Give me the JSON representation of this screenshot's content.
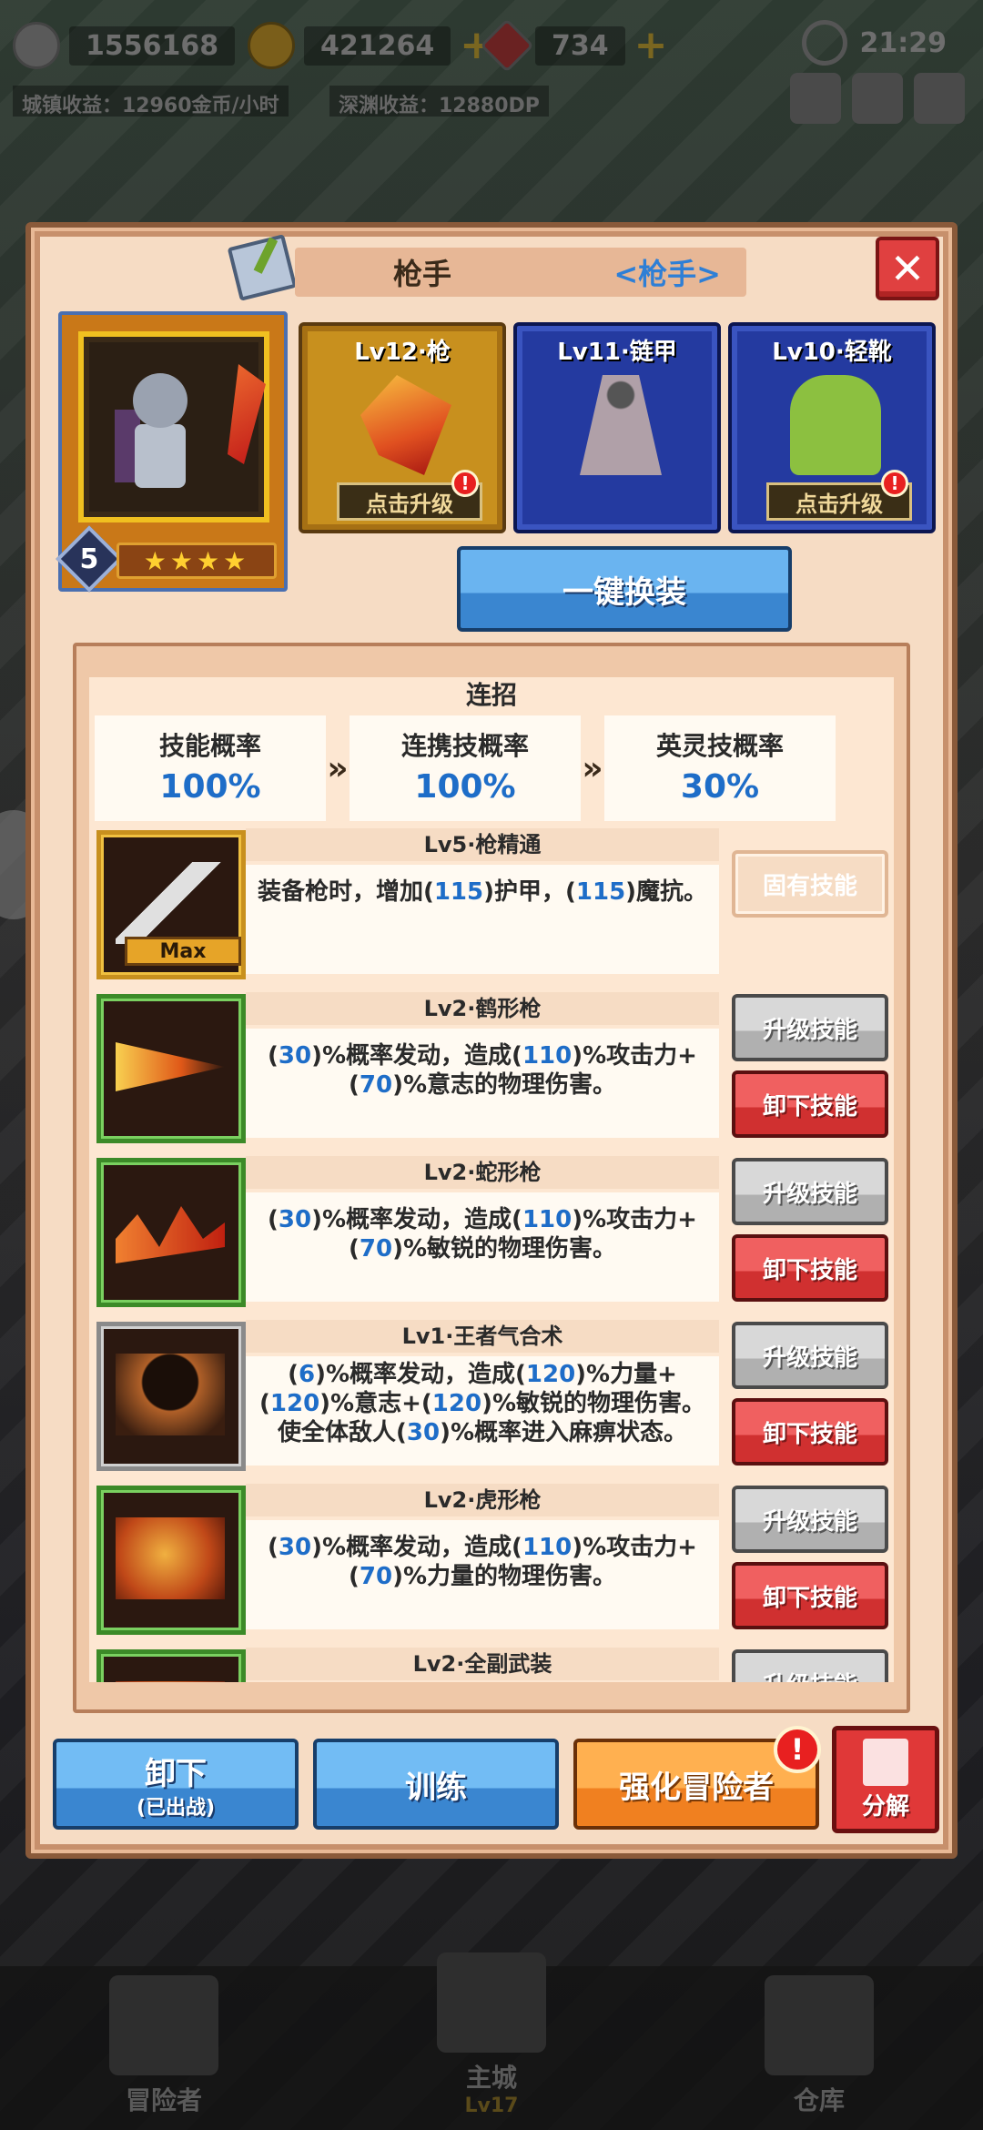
{
  "topbar": {
    "power": "1556168",
    "gold": "421264",
    "gems": "734",
    "time": "21:29",
    "city_income": "城镇收益：12960金币/小时",
    "abyss_income": "深渊收益：12880DP"
  },
  "modal": {
    "title": "枪手",
    "class_tag": "<枪手>",
    "close_label": "✕"
  },
  "hero": {
    "level": "5",
    "stars": "★★★★"
  },
  "equipment": [
    {
      "label": "Lv12·枪",
      "upgrade": "点击升级",
      "alert": "!"
    },
    {
      "label": "Lv11·链甲"
    },
    {
      "label": "Lv10·轻靴",
      "upgrade": "点击升级",
      "alert": "!"
    }
  ],
  "one_key_label": "一键换装",
  "combo": {
    "title": "连招",
    "items": [
      {
        "label": "技能概率",
        "value": "100%"
      },
      {
        "label": "连携技概率",
        "value": "100%"
      },
      {
        "label": "英灵技概率",
        "value": "30%"
      }
    ],
    "arrow": "»"
  },
  "skills": [
    {
      "title": "Lv5·枪精通",
      "desc": "装备枪时，增加(115)护甲，(115)魔抗。",
      "tag": "Max",
      "innate_label": "固有技能"
    },
    {
      "title": "Lv2·鹤形枪",
      "desc": "(30)%概率发动，造成(110)%攻击力+(70)%意志的物理伤害。",
      "up_label": "升级技能",
      "down_label": "卸下技能"
    },
    {
      "title": "Lv2·蛇形枪",
      "desc": "(30)%概率发动，造成(110)%攻击力+(70)%敏锐的物理伤害。",
      "up_label": "升级技能",
      "down_label": "卸下技能"
    },
    {
      "title": "Lv1·王者气合术",
      "desc": "(6)%概率发动，造成(120)%力量+(120)%意志+(120)%敏锐的物理伤害。使全体敌人(30)%概率进入麻痹状态。",
      "up_label": "升级技能",
      "down_label": "卸下技能"
    },
    {
      "title": "Lv2·虎形枪",
      "desc": "(30)%概率发动，造成(110)%攻击力+(70)%力量的物理伤害。",
      "up_label": "升级技能",
      "down_label": "卸下技能"
    },
    {
      "title": "Lv2·全副武装",
      "desc": "",
      "up_label": "升级技能",
      "down_label": ""
    }
  ],
  "bottom": {
    "unequip_main": "卸下",
    "unequip_sub": "(已出战)",
    "train": "训练",
    "strengthen": "强化冒险者",
    "strengthen_alert": "!",
    "decompose": "分解"
  },
  "footer": {
    "adventurer": "冒险者",
    "main_city": "主城",
    "main_city_level": "Lv17",
    "warehouse": "仓库"
  },
  "colors": {
    "accent_blue": "#1e6dc8",
    "danger_red": "#e03838",
    "panel_bg": "#f6dcc4"
  }
}
